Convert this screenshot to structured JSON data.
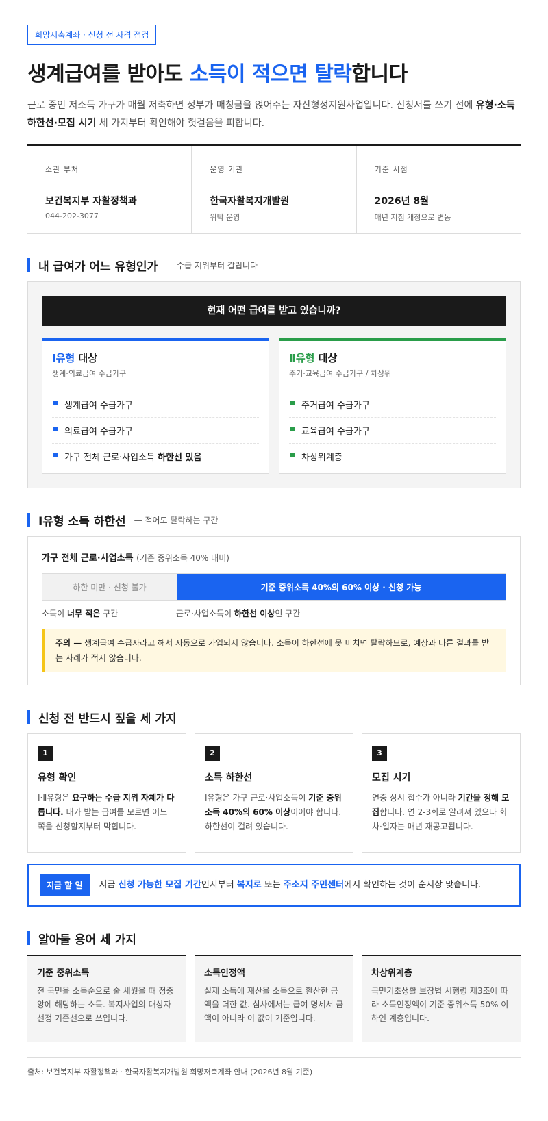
{
  "tag": "희망저축계좌 · 신청 전 자격 점검",
  "headline": {
    "pre": "생계급여를 받아도 ",
    "highlight": "소득이 적으면 탈락",
    "post": "합니다"
  },
  "lead": {
    "p1": "근로 중인 저소득 가구가 매월 저축하면 정부가 매칭금을 얹어주는 자산형성지원사업입니다. 신청서를 쓰기 전에 ",
    "bold": "유형·소득 하한선·모집 시기",
    "p2": " 세 가지부터 확인해야 헛걸음을 피합니다."
  },
  "meta": [
    {
      "label": "소관 부처",
      "value": "보건복지부 자활정책과",
      "sub": "044-202-3077"
    },
    {
      "label": "운영 기관",
      "value": "한국자활복지개발원",
      "sub": "위탁 운영"
    },
    {
      "label": "기준 시점",
      "value": "2026년 8월",
      "sub": "매년 지침 개정으로 변동"
    }
  ],
  "section1": {
    "title": "내 급여가 어느 유형인가",
    "note": "— 수급 지위부터 갈립니다",
    "question": "현재 어떤 급여를 받고 있습니까?",
    "type1": {
      "name_accent": "Ⅰ유형",
      "name_rest": " 대상",
      "desc": "생계·의료급여 수급가구",
      "items": [
        "생계급여 수급가구",
        "의료급여 수급가구"
      ],
      "item3_pre": "가구 전체 근로·사업소득 ",
      "item3_bold": "하한선 있음"
    },
    "type2": {
      "name_accent": "Ⅱ유형",
      "name_rest": " 대상",
      "desc": "주거·교육급여 수급가구 / 차상위",
      "items": [
        "주거급여 수급가구",
        "교육급여 수급가구",
        "차상위계층"
      ]
    }
  },
  "section2": {
    "title": "Ⅰ유형 소득 하한선",
    "note": "— 적어도 탈락하는 구간",
    "bar_title": "가구 전체 근로·사업소득",
    "bar_title_note": "(기준 중위소득 40% 대비)",
    "low_label": "하한 미만 · 신청 불가",
    "high_label": "기준 중위소득 40%의 60% 이상 · 신청 가능",
    "low_share": 0.3,
    "cap1_pre": "소득이 ",
    "cap1_bold": "너무 적은",
    "cap1_post": " 구간",
    "cap2_pre": "근로·사업소득이 ",
    "cap2_bold": "하한선 이상",
    "cap2_post": "인 구간",
    "warn_bold": "주의 —",
    "warn_text": " 생계급여 수급자라고 해서 자동으로 가입되지 않습니다. 소득이 하한선에 못 미치면 탈락하므로, 예상과 다른 결과를 받는 사례가 적지 않습니다."
  },
  "section3": {
    "title": "신청 전 반드시 짚을 세 가지",
    "cards": [
      {
        "num": "1",
        "title": "유형 확인",
        "pre": "Ⅰ·Ⅱ유형은 ",
        "bold": "요구하는 수급 지위 자체가 다릅니다.",
        "post": " 내가 받는 급여를 모르면 어느 쪽을 신청할지부터 막힙니다."
      },
      {
        "num": "2",
        "title": "소득 하한선",
        "pre": "Ⅰ유형은 가구 근로·사업소득이 ",
        "bold": "기준 중위소득 40%의 60% 이상",
        "post": "이어야 합니다. 하한선이 걸려 있습니다."
      },
      {
        "num": "3",
        "title": "모집 시기",
        "pre": "연중 상시 접수가 아니라 ",
        "bold": "기간을 정해 모집",
        "post": "합니다. 연 2-3회로 알려져 있으나 회차·일자는 매년 재공고됩니다."
      }
    ],
    "now_badge": "지금 할 일",
    "now_1": "지금 ",
    "now_b1": "신청 가능한 모집 기간",
    "now_2": "인지부터 ",
    "now_b2": "복지로",
    "now_3": " 또는 ",
    "now_b3": "주소지 주민센터",
    "now_4": "에서 확인하는 것이 순서상 맞습니다."
  },
  "section4": {
    "title": "알아둘 용어 세 가지",
    "terms": [
      {
        "title": "기준 중위소득",
        "body": "전 국민을 소득순으로 줄 세웠을 때 정중앙에 해당하는 소득. 복지사업의 대상자 선정 기준선으로 쓰입니다."
      },
      {
        "title": "소득인정액",
        "body": "실제 소득에 재산을 소득으로 환산한 금액을 더한 값. 심사에서는 급여 명세서 금액이 아니라 이 값이 기준입니다."
      },
      {
        "title": "차상위계층",
        "body": "국민기초생활 보장법 시행령 제3조에 따라 소득인정액이 기준 중위소득 50% 이하인 계층입니다."
      }
    ]
  },
  "source": "출처: 보건복지부 자활정책과 · 한국자활복지개발원 희망저축계좌 안내 (2026년 8월 기준)"
}
